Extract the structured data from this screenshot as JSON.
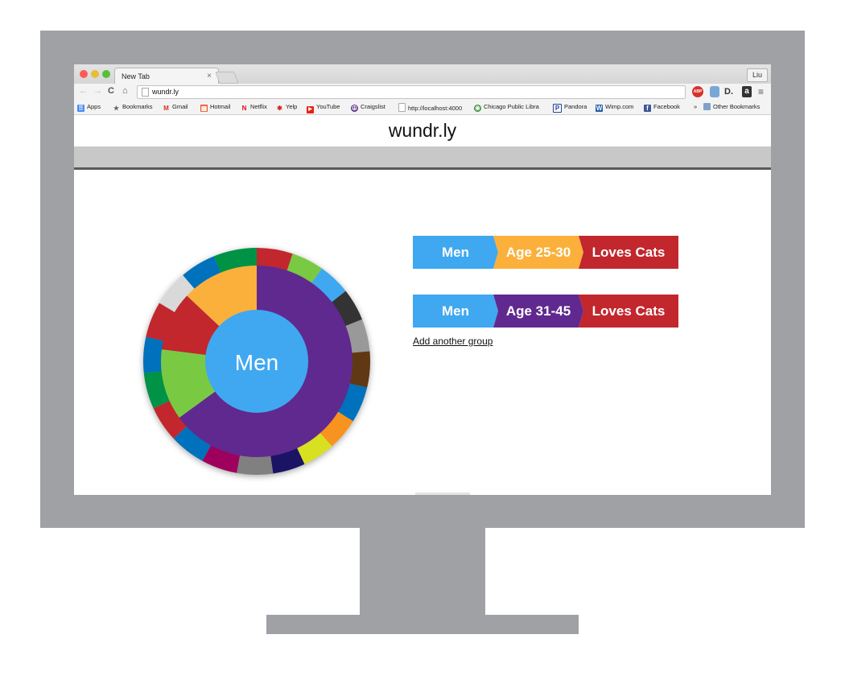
{
  "browser": {
    "tab_title": "New Tab",
    "tab_close": "×",
    "user_label": "Liu",
    "url": "wundr.ly",
    "bookmarks": [
      {
        "label": "Apps",
        "color": "#4c8bf5",
        "glyph": "⠿"
      },
      {
        "label": "Bookmarks",
        "color": "#666666",
        "glyph": "★"
      },
      {
        "label": "Gmail",
        "color": "#d93025",
        "glyph": "M"
      },
      {
        "label": "Hotmail",
        "color": "#f25022",
        "glyph": "▦"
      },
      {
        "label": "Netflix",
        "color": "#e50914",
        "glyph": "N"
      },
      {
        "label": "Yelp",
        "color": "#d32323",
        "glyph": "✱"
      },
      {
        "label": "YouTube",
        "color": "#e62117",
        "glyph": "▶"
      },
      {
        "label": "Craigslist",
        "color": "#5a2d82",
        "glyph": "☮"
      },
      {
        "label": "http://localhost:4000",
        "color": "#9a9a9a",
        "glyph": ""
      },
      {
        "label": "Chicago Public Libra",
        "color": "#3c8d3a",
        "glyph": "❀"
      },
      {
        "label": "Pandora",
        "color": "#224099",
        "glyph": "P"
      },
      {
        "label": "Wimp.com",
        "color": "#1f5fa8",
        "glyph": "W"
      },
      {
        "label": "Facebook",
        "color": "#3b5998",
        "glyph": "f"
      }
    ],
    "bookmarks_more": "»",
    "other_bookmarks": "Other Bookmarks"
  },
  "app": {
    "title": "wundr.ly"
  },
  "sunburst": {
    "center_label": "Men",
    "center_color": "#3fa8f0",
    "inner_ring": [
      {
        "value": 25,
        "color": "#60298f"
      },
      {
        "value": 25,
        "color": "#60298f"
      },
      {
        "value": 15,
        "color": "#60298f"
      },
      {
        "value": 12,
        "color": "#7ac943"
      },
      {
        "value": 10,
        "color": "#c1272d"
      },
      {
        "value": 13,
        "color": "#fbb03b"
      }
    ],
    "outer_ring": [
      {
        "value": 5,
        "color": "#c1272d"
      },
      {
        "value": 4.5,
        "color": "#7ac943"
      },
      {
        "value": 4.5,
        "color": "#3fa8f0"
      },
      {
        "value": 4.5,
        "color": "#333333"
      },
      {
        "value": 4.5,
        "color": "#999999"
      },
      {
        "value": 5,
        "color": "#603813"
      },
      {
        "value": 5,
        "color": "#0071bc"
      },
      {
        "value": 4.5,
        "color": "#f7931e"
      },
      {
        "value": 4.5,
        "color": "#d9e021"
      },
      {
        "value": 4.5,
        "color": "#1b1464"
      },
      {
        "value": 5,
        "color": "#808080"
      },
      {
        "value": 5,
        "color": "#9e005d"
      },
      {
        "value": 5,
        "color": "#0071bc"
      },
      {
        "value": 5,
        "color": "#c1272d"
      },
      {
        "value": 5,
        "color": "#009245"
      },
      {
        "value": 5,
        "color": "#0071bc"
      },
      {
        "value": 5,
        "color": "#c1272d"
      },
      {
        "value": 5,
        "color": "#d9d9d9"
      },
      {
        "value": 5,
        "color": "#0071bc"
      },
      {
        "value": 6,
        "color": "#009245"
      }
    ]
  },
  "groups": [
    {
      "segments": [
        {
          "label": "Men",
          "color": "#3fa8f0"
        },
        {
          "label": "Age 25-30",
          "color": "#fbb03b"
        },
        {
          "label": "Loves Cats",
          "color": "#c1272d"
        }
      ]
    },
    {
      "segments": [
        {
          "label": "Men",
          "color": "#3fa8f0"
        },
        {
          "label": "Age 31-45",
          "color": "#60298f"
        },
        {
          "label": "Loves Cats",
          "color": "#c1272d"
        }
      ]
    }
  ],
  "add_group_label": "Add another group"
}
